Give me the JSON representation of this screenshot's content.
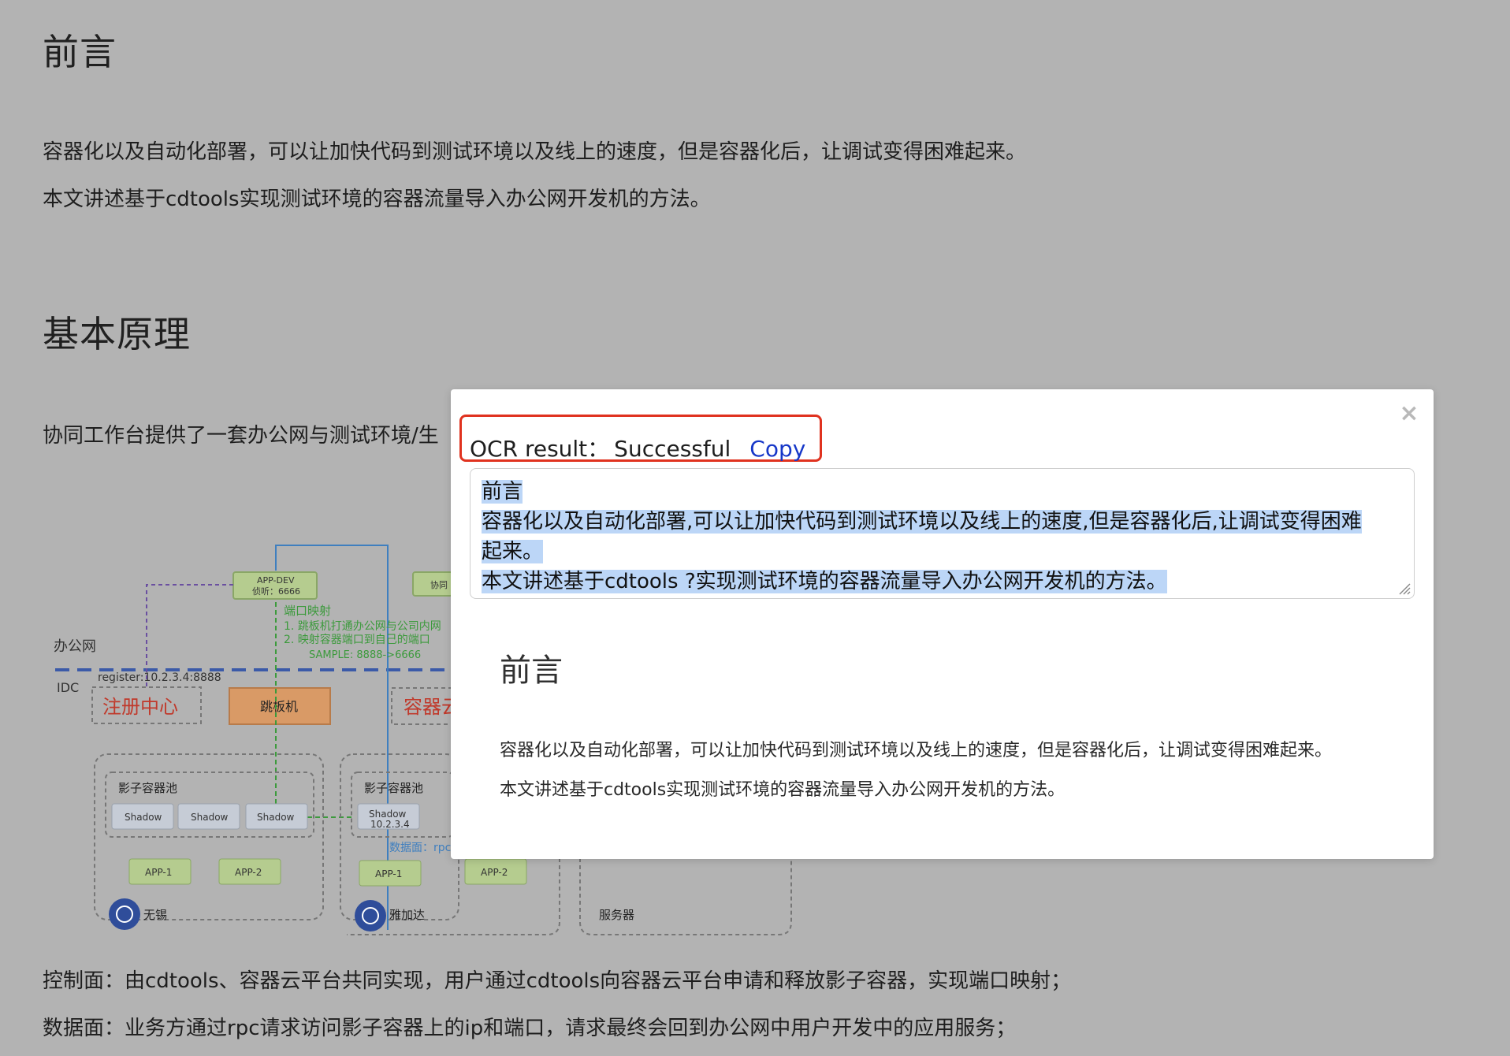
{
  "article": {
    "section1_title": "前言",
    "section1_p1": "容器化以及自动化部署，可以让加快代码到测试环境以及线上的速度，但是容器化后，让调试变得困难起来。",
    "section1_p2": "本文讲述基于cdtools实现测试环境的容器流量导入办公网开发机的方法。",
    "section2_title": "基本原理",
    "section2_p1": "协同工作台提供了一套办公网与测试环境/生",
    "control_plane": "控制面：由cdtools、容器云平台共同实现，用户通过cdtools向容器云平台申请和释放影子容器，实现端口映射；",
    "data_plane": "数据面：业务方通过rpc请求访问影子容器上的ip和端口，请求最终会回到办公网中用户开发中的应用服务；"
  },
  "diagram": {
    "office_net": "办公网",
    "idc": "IDC",
    "register": "register:10.2.3.4:8888",
    "registry_center": "注册中心",
    "jump_host": "跳板机",
    "container_partial": "容器云",
    "app_dev_line1": "APP-DEV",
    "app_dev_line2": "侦听：6666",
    "cooperate_partial": "协同",
    "port_mapping": "端口映射",
    "pm_step1": "1.   跳板机打通办公网与公司内网",
    "pm_step2": "2.   映射容器端口到自己的端口",
    "pm_sample": "SAMPLE: 8888->6666",
    "shadow_pool": "影子容器池",
    "shadow": "Shadow",
    "shadow_ip": "10.2.3.4",
    "data_plane_label": "数据面：rpc",
    "app1": "APP-1",
    "app2": "APP-2",
    "site_wuxi": "无锡",
    "site_jakarta": "雅加达",
    "server": "服务器"
  },
  "modal": {
    "status_label": "OCR result：",
    "status_value": "Successful",
    "copy_label": "Copy",
    "close_glyph": "×",
    "ocr_lines": [
      "前言 ",
      "容器化以及自动化部署,可以让加快代码到测试环境以及线上的速度,但是容器化后,让调试变得困难",
      "起来。 ",
      "本文讲述基于cdtools ?实现测试环境的容器流量导入办公网开发机的方法。"
    ],
    "preview_title": "前言",
    "preview_p1": "容器化以及自动化部署，可以让加快代码到测试环境以及线上的速度，但是容器化后，让调试变得困难起来。",
    "preview_p2": "本文讲述基于cdtools实现测试环境的容器流量导入办公网开发机的方法。"
  }
}
